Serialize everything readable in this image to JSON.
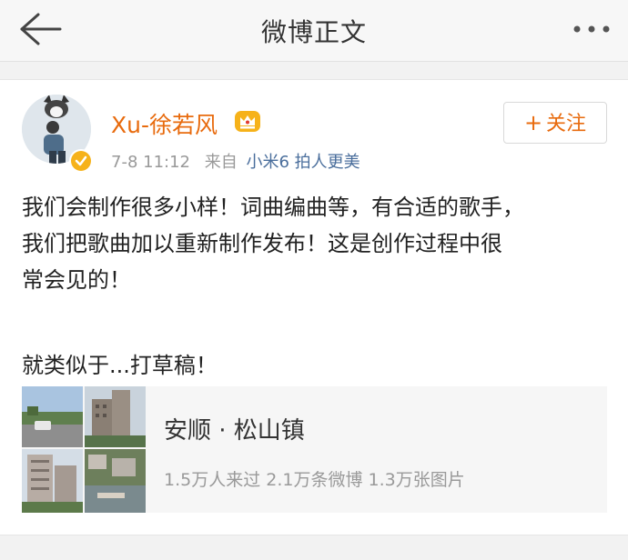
{
  "navbar": {
    "title": "微博正文",
    "back_icon": "back-arrow-icon",
    "more_icon": "more-dots-icon"
  },
  "post": {
    "username": "Xu-徐若风",
    "time": "7-8 11:12",
    "source_prefix": "来自",
    "source": "小米6 拍人更美",
    "follow_label": "关注",
    "text_lines": [
      "我们会制作很多小样！词曲编曲等，有合适的歌手，",
      "我们把歌曲加以重新制作发布！这是创作过程中很",
      "常会见的！"
    ],
    "text_para2": "就类似于...打草稿！",
    "location": {
      "name": "安顺 · 松山镇",
      "stats": "1.5万人来过 2.1万条微博 1.3万张图片"
    }
  },
  "colors": {
    "username": "#e86b0e",
    "source_link": "#4a6e9c",
    "badge": "#f6b21a"
  }
}
